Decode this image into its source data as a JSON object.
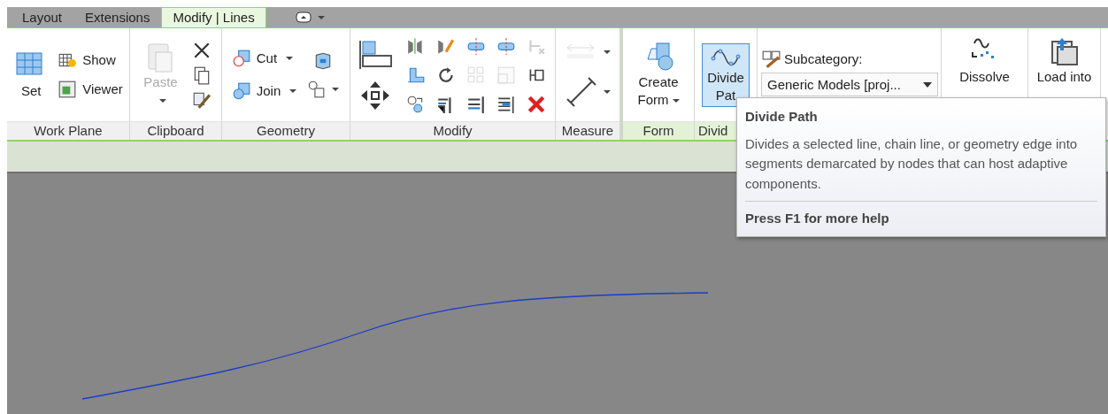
{
  "tabs": [
    {
      "label": "Layout",
      "selected": false
    },
    {
      "label": "Extensions",
      "selected": false
    },
    {
      "label": "Modify | Lines",
      "selected": true
    }
  ],
  "ribbon": {
    "panels": [
      {
        "label": "Work Plane",
        "contextual": false,
        "tools": [
          {
            "label": "Set"
          },
          {
            "label": "Show"
          },
          {
            "label": "Viewer"
          }
        ]
      },
      {
        "label": "Clipboard",
        "contextual": false,
        "tools": [
          {
            "label": "Paste",
            "disabled": true,
            "dropdown": true
          }
        ]
      },
      {
        "label": "Geometry",
        "contextual": false,
        "tools": [
          {
            "label": "Cut",
            "dropdown": true
          },
          {
            "label": "Join",
            "dropdown": true
          }
        ]
      },
      {
        "label": "Modify",
        "contextual": false,
        "tools": [
          {
            "disabled": false
          },
          {
            "disabled": false
          },
          {
            "disabled": false
          },
          {
            "disabled": false
          },
          {
            "disabled": true
          },
          {
            "disabled": false
          },
          {
            "disabled": false
          },
          {
            "disabled": true
          },
          {
            "disabled": true
          },
          {
            "disabled": false
          },
          {
            "disabled": false
          },
          {
            "disabled": false
          },
          {
            "disabled": false
          },
          {
            "disabled": false
          },
          {
            "disabled": false
          }
        ]
      },
      {
        "label": "Measure",
        "contextual": false,
        "tools": [
          {
            "disabled": true
          },
          {
            "disabled": false
          }
        ]
      },
      {
        "label": "Form",
        "contextual": true,
        "tools": [
          {
            "label": "Create Form",
            "dropdown": true
          }
        ]
      },
      {
        "label": "Divid",
        "contextual": true,
        "tools": [
          {
            "label": "Divide Pat",
            "selected": true
          }
        ]
      }
    ],
    "subcategory": {
      "label": "Subcategory:",
      "value": "Generic Models [proj..."
    },
    "dissolve": {
      "label": "Dissolve"
    },
    "load": {
      "label": "Load into"
    }
  },
  "tooltip": {
    "title": "Divide Path",
    "description": "Divides a selected line, chain line, or geometry edge into segments demarcated by nodes that can host adaptive components.",
    "help": "Press F1 for more help"
  }
}
